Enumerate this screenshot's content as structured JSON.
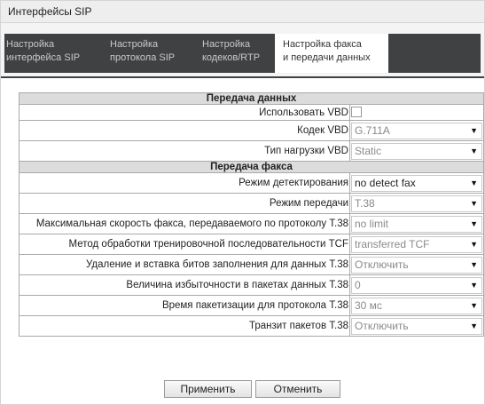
{
  "window": {
    "title": "Интерфейсы SIP"
  },
  "tabs": [
    {
      "line1": "Настройка",
      "line2": "интерфейса SIP"
    },
    {
      "line1": "Настройка",
      "line2": "протокола SIP"
    },
    {
      "line1": "Настройка",
      "line2": "кодеков/RTP"
    },
    {
      "line1": "Настройка факса",
      "line2": "и передачи данных"
    }
  ],
  "active_tab": 3,
  "sections": {
    "data_transfer": {
      "title": "Передача данных",
      "use_vbd": {
        "label": "Использовать VBD",
        "checked": false
      },
      "vbd_codec": {
        "label": "Кодек VBD",
        "value": "G.711A"
      },
      "vbd_payload": {
        "label": "Тип нагрузки VBD",
        "value": "Static"
      }
    },
    "fax_transfer": {
      "title": "Передача факса",
      "detect_mode": {
        "label": "Режим детектирования",
        "value": "no detect fax"
      },
      "transfer_mode": {
        "label": "Режим передачи",
        "value": "T.38"
      },
      "max_speed": {
        "label": "Максимальная скорость факса, передаваемого по протоколу T.38",
        "value": "no limit"
      },
      "tcf_method": {
        "label": "Метод обработки тренировочной последовательности TCF",
        "value": "transferred TCF"
      },
      "fill_bits": {
        "label": "Удаление и вставка битов заполнения для данных T.38",
        "value": "Отключить"
      },
      "redundancy": {
        "label": "Величина избыточности в пакетах данных T.38",
        "value": "0"
      },
      "packet_time": {
        "label": "Время пакетизации для протокола T.38",
        "value": "30 мс"
      },
      "transit": {
        "label": "Транзит пакетов T.38",
        "value": "Отключить"
      }
    }
  },
  "buttons": {
    "apply": "Применить",
    "cancel": "Отменить"
  },
  "icons": {
    "dropdown": "dropdown-arrow-icon",
    "arrow_glyph": "▼"
  }
}
